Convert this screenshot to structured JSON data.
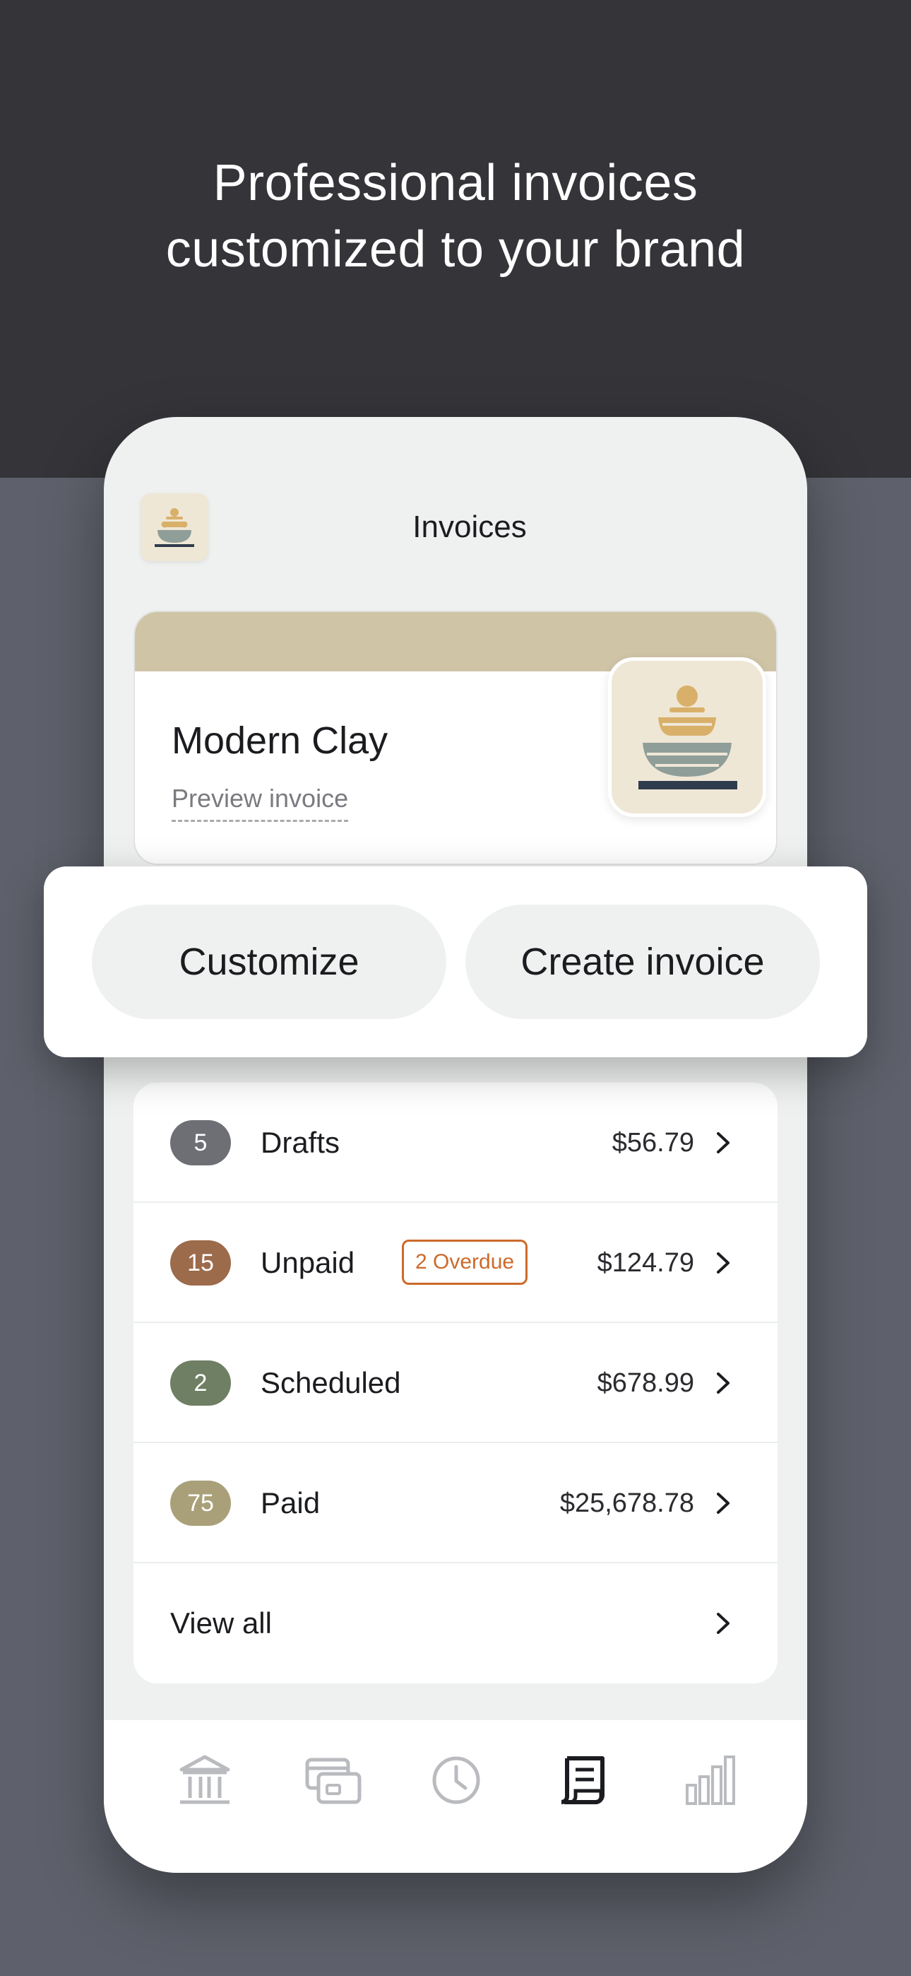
{
  "headline": {
    "line1": "Professional invoices",
    "line2": "customized to your brand"
  },
  "header": {
    "title": "Invoices",
    "brand_icon": "stacked-bowls-logo-icon"
  },
  "brand_card": {
    "name": "Modern Clay",
    "preview_label": "Preview invoice",
    "band_color": "#cfc4a6",
    "logo_icon": "stacked-bowls-logo-icon"
  },
  "actions": {
    "customize_label": "Customize",
    "create_label": "Create invoice"
  },
  "invoice_groups": [
    {
      "count": "5",
      "label": "Drafts",
      "amount": "$56.79",
      "badge_color": "#6d6f75"
    },
    {
      "count": "15",
      "label": "Unpaid",
      "overdue": "2 Overdue",
      "amount": "$124.79",
      "badge_color": "#9c6b4b"
    },
    {
      "count": "2",
      "label": "Scheduled",
      "amount": "$678.99",
      "badge_color": "#6f7f63"
    },
    {
      "count": "75",
      "label": "Paid",
      "amount": "$25,678.78",
      "badge_color": "#a9a079"
    }
  ],
  "view_all_label": "View all",
  "tab_bar": {
    "active_tab": "invoices",
    "tabs": [
      {
        "id": "bank",
        "icon": "bank-icon"
      },
      {
        "id": "cards",
        "icon": "card-icon"
      },
      {
        "id": "history",
        "icon": "clock-icon"
      },
      {
        "id": "invoices",
        "icon": "invoice-icon"
      },
      {
        "id": "insights",
        "icon": "bar-chart-icon"
      }
    ]
  },
  "colors": {
    "overdue": "#cc6a2a",
    "active_tab": "#1b1c1f",
    "inactive_tab": "#b9bbbf"
  }
}
